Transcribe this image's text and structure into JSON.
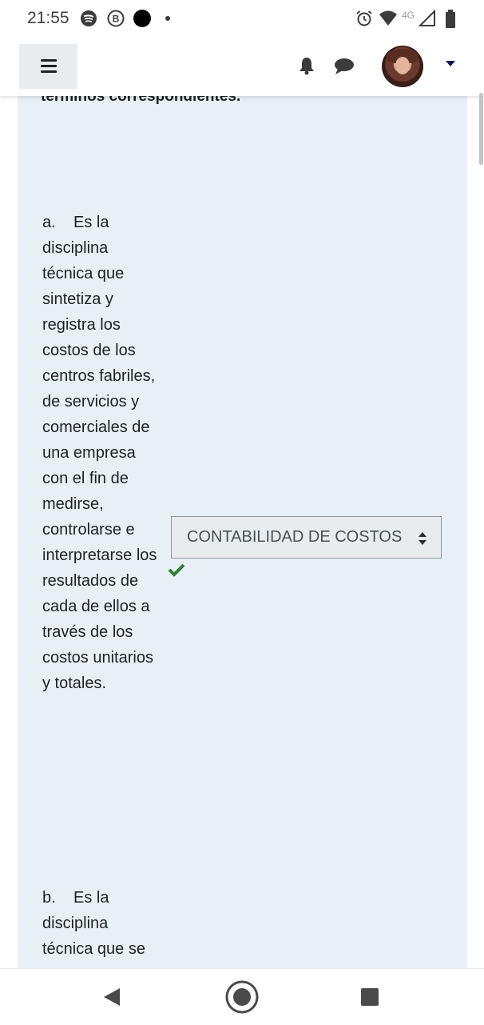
{
  "status_bar": {
    "time": "21:55",
    "network": "4G",
    "icons": [
      "spotify-icon",
      "b-icon",
      "record-dot-icon",
      "dot-icon",
      "alarm-icon",
      "wifi-icon",
      "signal-icon",
      "battery-icon"
    ]
  },
  "navbar": {
    "icons": [
      "hamburger-menu-icon",
      "bell-icon",
      "chat-bubble-icon",
      "avatar",
      "caret-down-icon"
    ]
  },
  "question": {
    "prompt_fragment": "términos correspondientes.",
    "items": [
      {
        "label": "a.",
        "text": "Es la disciplina técnica que sintetiza y registra los costos de los centros fabriles, de servicios y comerciales de una empresa con el fin de medirse, controlarse e interpretarse los resultados de cada de ellos a través de los costos unitarios y totales.",
        "selected_answer": "CONTABILIDAD DE COSTOS",
        "correct": true
      },
      {
        "label": "b.",
        "text": "Es la disciplina técnica que se"
      }
    ]
  },
  "colors": {
    "card_bg": "#e7f1f5",
    "select_bg": "#e9ecef",
    "check_green": "#2e7d32",
    "caret_navy": "#0f1a4d"
  }
}
